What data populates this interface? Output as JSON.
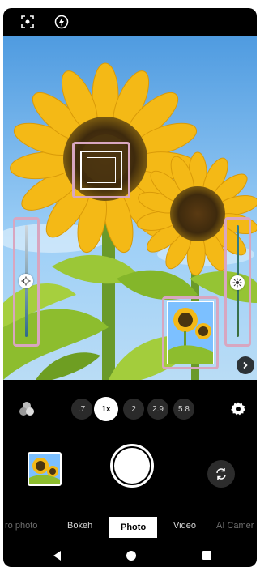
{
  "topbar": {
    "icons": [
      "face-detect-icon",
      "flash-icon"
    ]
  },
  "viewfinder": {
    "focus": "focus-frame",
    "brightness_slider": {
      "icon": "brightness-icon",
      "level": 0.5
    },
    "white_balance_slider": {
      "icon": "white-balance-icon",
      "level": 0.5
    },
    "preview": "mini-preview",
    "more": "chevron-right-icon"
  },
  "zoom": {
    "levels": [
      ".7",
      "1x",
      "2",
      "2.9",
      "5.8"
    ],
    "active": "1x"
  },
  "controls": {
    "effects_icon": "color-effects-icon",
    "settings_icon": "gear-icon",
    "shutter": "shutter-button",
    "switch_icon": "switch-camera-icon"
  },
  "modes": [
    "ro photo",
    "Bokeh",
    "Photo",
    "Video",
    "AI Camer"
  ],
  "nav": [
    "back",
    "home",
    "recents"
  ],
  "colors": {
    "highlight": "#d8a6c0",
    "sky": "#6fb3ea",
    "petal": "#f6c21a",
    "leaf": "#8dbd2e"
  }
}
